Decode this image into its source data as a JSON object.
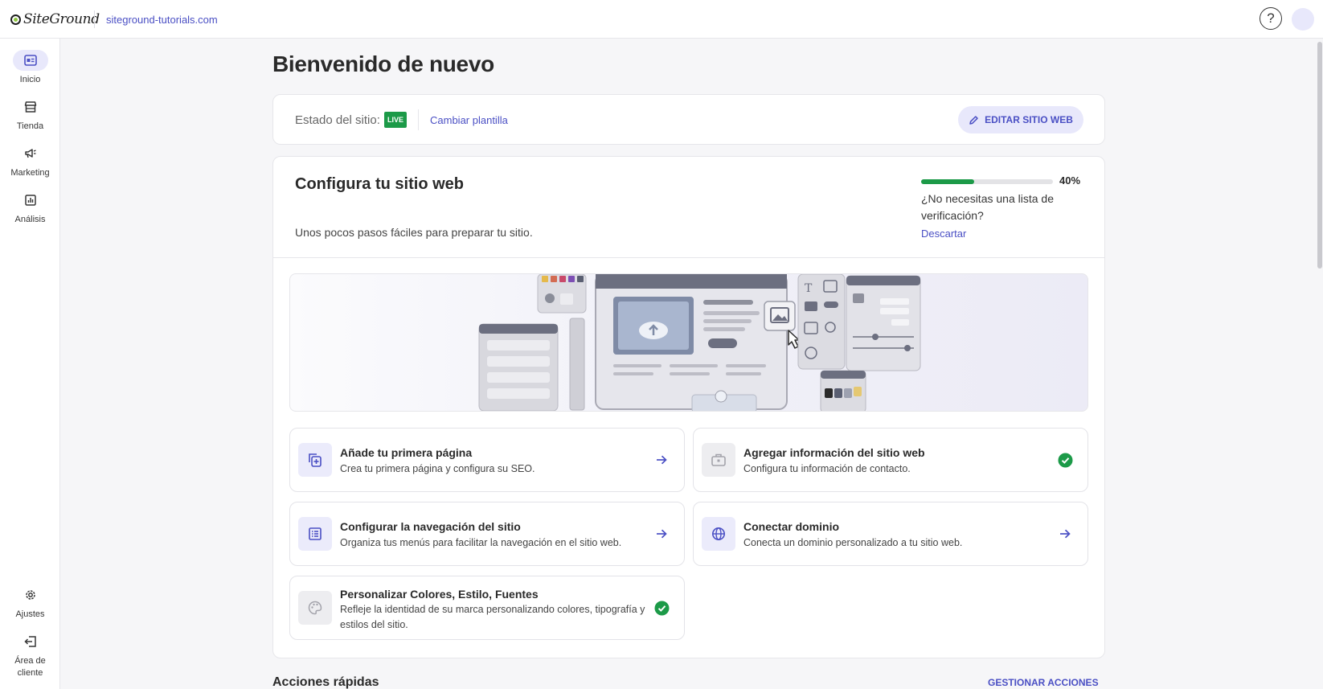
{
  "topbar": {
    "logo_text": "SiteGround",
    "site_url": "siteground-tutorials.com",
    "help_label": "?"
  },
  "sidebar": {
    "items": [
      {
        "label": "Inicio",
        "icon": "dashboard-icon",
        "active": true
      },
      {
        "label": "Tienda",
        "icon": "store-icon",
        "active": false
      },
      {
        "label": "Marketing",
        "icon": "megaphone-icon",
        "active": false
      },
      {
        "label": "Análisis",
        "icon": "chart-icon",
        "active": false
      }
    ],
    "bottom_items": [
      {
        "label": "Ajustes",
        "icon": "gear-icon"
      },
      {
        "label_line1": "Área de",
        "label_line2": "cliente",
        "icon": "logout-icon"
      }
    ]
  },
  "main": {
    "title": "Bienvenido de nuevo",
    "status": {
      "label": "Estado del sitio:",
      "badge": "LIVE",
      "change_template": "Cambiar plantilla",
      "edit_button": "EDITAR SITIO WEB"
    },
    "setup": {
      "title": "Configura tu sitio web",
      "subtitle": "Unos pocos pasos fáciles para preparar tu sitio.",
      "progress_value": 0.4,
      "progress_label": "40%",
      "checklist_question": "¿No necesitas una lista de verificación?",
      "dismiss": "Descartar",
      "tasks": [
        {
          "title": "Añade tu primera página",
          "desc": "Crea tu primera página y configura su SEO.",
          "icon": "add-page-icon",
          "status": "pending"
        },
        {
          "title": "Agregar información del sitio web",
          "desc": "Configura tu información de contacto.",
          "icon": "briefcase-icon",
          "status": "done"
        },
        {
          "title": "Configurar la navegación del sitio",
          "desc": "Organiza tus menús para facilitar la navegación en el sitio web.",
          "icon": "list-icon",
          "status": "pending"
        },
        {
          "title": "Conectar dominio",
          "desc": "Conecta un dominio personalizado a tu sitio web.",
          "icon": "globe-icon",
          "status": "pending"
        },
        {
          "title": "Personalizar Colores, Estilo, Fuentes",
          "desc": "Refleje la identidad de su marca personalizando colores, tipografía y estilos del sitio.",
          "icon": "palette-icon",
          "status": "done"
        }
      ]
    },
    "quick_actions": {
      "title": "Acciones rápidas",
      "manage": "GESTIONAR ACCIONES"
    }
  },
  "colors": {
    "accent": "#4a4fc4",
    "success": "#1c9a48",
    "accent_light": "#e8e8fb"
  }
}
